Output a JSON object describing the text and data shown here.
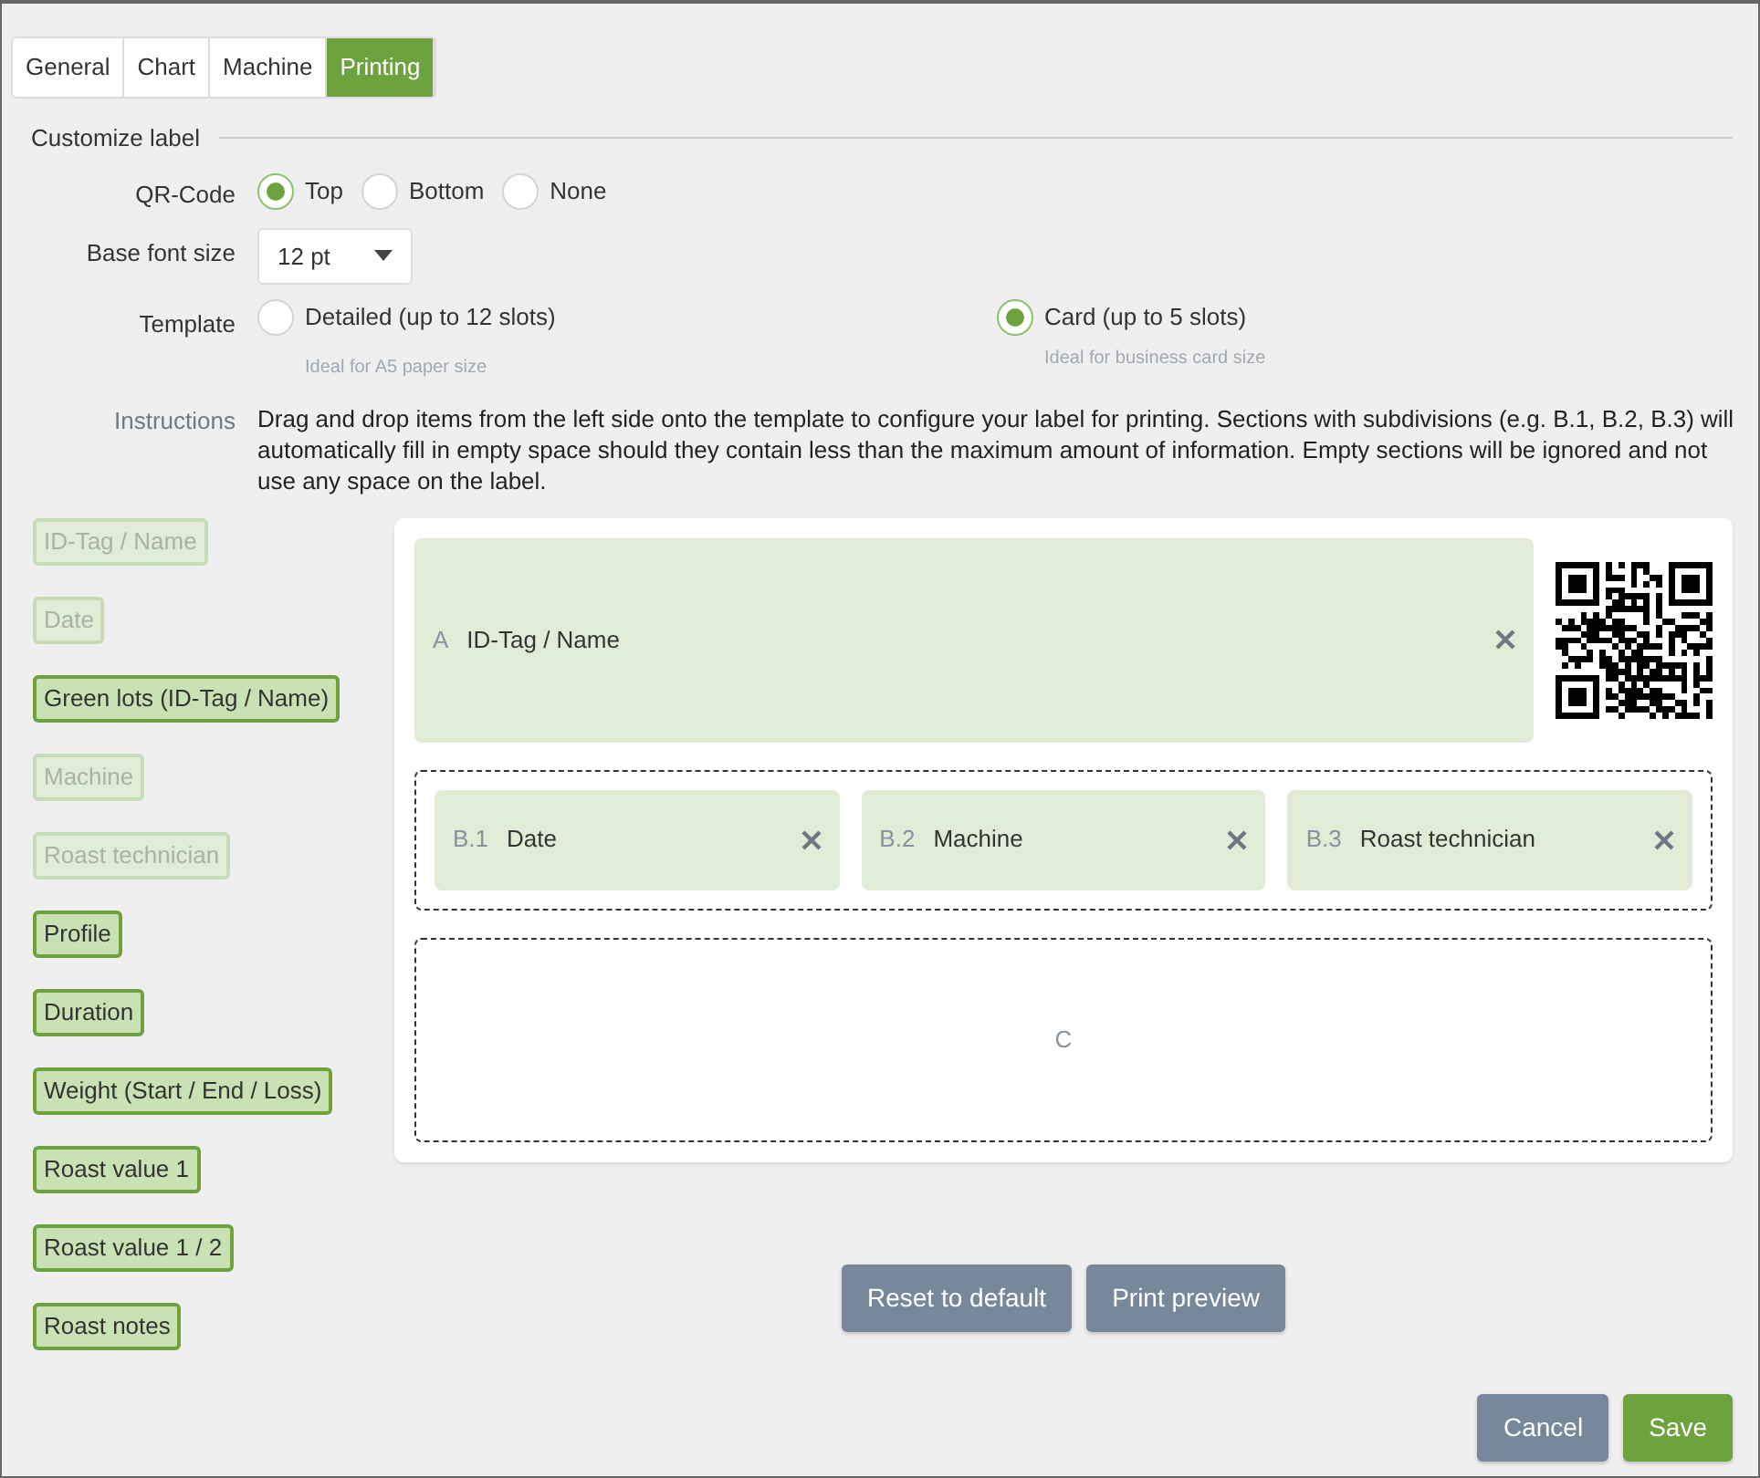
{
  "tabs": [
    {
      "label": "General",
      "selected": false
    },
    {
      "label": "Chart",
      "selected": false
    },
    {
      "label": "Machine",
      "selected": false
    },
    {
      "label": "Printing",
      "selected": true
    }
  ],
  "section_title": "Customize label",
  "qr_code": {
    "label": "QR-Code",
    "options": [
      {
        "label": "Top",
        "selected": true
      },
      {
        "label": "Bottom",
        "selected": false
      },
      {
        "label": "None",
        "selected": false
      }
    ]
  },
  "font_size": {
    "label": "Base font size",
    "value": "12 pt"
  },
  "template": {
    "label": "Template",
    "options": [
      {
        "label": "Detailed (up to 12 slots)",
        "hint": "Ideal for A5 paper size",
        "selected": false
      },
      {
        "label": "Card (up to 5 slots)",
        "hint": "Ideal for business card size",
        "selected": true
      }
    ]
  },
  "instructions": {
    "label": "Instructions",
    "text": "Drag and drop items from the left side onto the template to configure your label for printing. Sections with subdivisions (e.g. B.1, B.2, B.3) will automatically fill in empty space should they contain less than the maximum amount of information. Empty sections will be ignored and not use any space on the label."
  },
  "items": [
    {
      "label": "ID-Tag / Name",
      "disabled": true
    },
    {
      "label": "Date",
      "disabled": true
    },
    {
      "label": "Green lots (ID-Tag / Name)",
      "disabled": false
    },
    {
      "label": "Machine",
      "disabled": true
    },
    {
      "label": "Roast technician",
      "disabled": true
    },
    {
      "label": "Profile",
      "disabled": false
    },
    {
      "label": "Duration",
      "disabled": false
    },
    {
      "label": "Weight (Start / End / Loss)",
      "disabled": false
    },
    {
      "label": "Roast value 1",
      "disabled": false
    },
    {
      "label": "Roast value 1 / 2",
      "disabled": false
    },
    {
      "label": "Roast notes",
      "disabled": false
    }
  ],
  "sections": [
    {
      "kind": "single",
      "slots": [
        {
          "letter": "A",
          "value": "ID-Tag / Name"
        }
      ]
    },
    {
      "kind": "split",
      "slots": [
        {
          "letter": "B.1",
          "value": "Date"
        },
        {
          "letter": "B.2",
          "value": "Machine"
        },
        {
          "letter": "B.3",
          "value": "Roast technician"
        }
      ]
    },
    {
      "kind": "empty",
      "letter": "C"
    }
  ],
  "actions": [
    {
      "label": "Reset to default",
      "kind": "secondary"
    },
    {
      "label": "Print preview",
      "kind": "secondary"
    }
  ],
  "footer": [
    {
      "label": "Cancel",
      "kind": "secondary"
    },
    {
      "label": "Save",
      "kind": "primary"
    }
  ]
}
